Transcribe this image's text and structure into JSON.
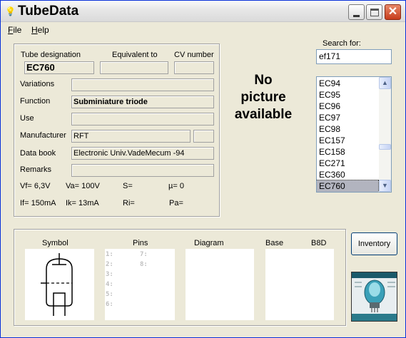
{
  "window": {
    "title": "TubeData"
  },
  "menu": {
    "file": "File",
    "help": "Help"
  },
  "details": {
    "tube_designation_label": "Tube designation",
    "tube_designation_value": "EC760",
    "equivalent_label": "Equivalent to",
    "equivalent_value": "",
    "cv_label": "CV number",
    "cv_value": "",
    "variations_label": "Variations",
    "variations_value": "",
    "function_label": "Function",
    "function_value": "Subminiature triode",
    "use_label": "Use",
    "use_value": "",
    "manufacturer_label": "Manufacturer",
    "manufacturer_value": "RFT",
    "manufacturer_extra": "",
    "databook_label": "Data book",
    "databook_value": "Electronic Univ.VadeMecum -94",
    "remarks_label": "Remarks",
    "remarks_value": ""
  },
  "params": {
    "vf": "Vf= 6,3V",
    "va": "Va= 100V",
    "s": "S=",
    "mu": "µ=   0",
    "if": "If= 150mA",
    "ik": "Ik=  13mA",
    "ri": "Ri=",
    "pa": "Pa="
  },
  "picture": {
    "line1": "No",
    "line2": "picture",
    "line3": "available"
  },
  "search": {
    "label": "Search for:",
    "value": "ef171"
  },
  "tube_list": {
    "items": [
      "EC94",
      "EC95",
      "EC96",
      "EC97",
      "EC98",
      "EC157",
      "EC158",
      "EC271",
      "EC360",
      "EC760"
    ],
    "selected": "EC760"
  },
  "bottom": {
    "symbol_label": "Symbol",
    "pins_label": "Pins",
    "diagram_label": "Diagram",
    "base_label": "Base",
    "base_value": "B8D",
    "pins": [
      "1:",
      "2:",
      "3:",
      "4:",
      "5:",
      "6:",
      "7:",
      "8:"
    ]
  },
  "buttons": {
    "inventory": "Inventory"
  },
  "icons": {
    "app": "lightbulb-icon",
    "minimize": "minimize-icon",
    "maximize": "maximize-icon",
    "close": "close-icon"
  },
  "colors": {
    "title_close": "#c73c1c",
    "selection": "#b2b4bf",
    "logo_bg": "#2a7a8a"
  }
}
